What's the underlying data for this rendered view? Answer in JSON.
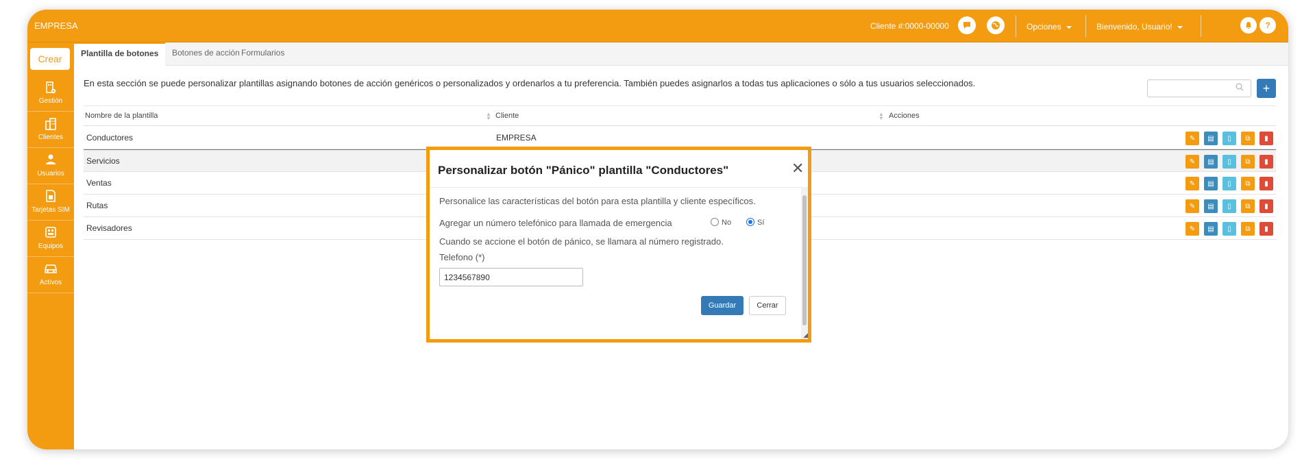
{
  "header": {
    "brand": "EMPRESA",
    "client_number": "Cliente #:0000-00000",
    "chat_icon": "chat-icon",
    "globe_icon": "globe-icon",
    "options_label": "Opciones",
    "welcome_label": "Bienvenido, Usuario!",
    "bell_icon": "bell-icon",
    "help_icon": "help-icon"
  },
  "sidebar": {
    "create_label": "Crear",
    "items": [
      {
        "label": "Gestión",
        "icon": "building-gear-icon"
      },
      {
        "label": "Clientes",
        "icon": "buildings-icon"
      },
      {
        "label": "Usuarios",
        "icon": "user-icon"
      },
      {
        "label": "Tarjetas SIM",
        "icon": "sim-card-icon"
      },
      {
        "label": "Equipos",
        "icon": "device-icon"
      },
      {
        "label": "Activos",
        "icon": "car-icon"
      }
    ]
  },
  "tabs": [
    "Plantilla de botones",
    "Botones de acción",
    "Formularios"
  ],
  "main": {
    "description": "En esta sección se puede personalizar plantillas asignando botones de acción genéricos o personalizados y ordenarlos a tu preferencia. También puedes asignarlos a todas tus aplicaciones o sólo a tus usuarios seleccionados.",
    "search_placeholder": "",
    "add_label": "+"
  },
  "table": {
    "columns": [
      "Nombre de la plantilla",
      "Cliente",
      "Acciones"
    ],
    "rows": [
      {
        "name": "Conductores",
        "client": "EMPRESA"
      },
      {
        "name": "Servicios",
        "client": ""
      },
      {
        "name": "Ventas",
        "client": ""
      },
      {
        "name": "Rutas",
        "client": ""
      },
      {
        "name": "Revisadores",
        "client": ""
      }
    ],
    "action_icons": [
      "edit-icon",
      "document-icon",
      "mobile-icon",
      "copy-icon",
      "delete-icon"
    ]
  },
  "modal": {
    "title": "Personalizar botón \"Pánico\" plantilla \"Conductores\"",
    "close_symbol": "✕",
    "intro": "Personalice las características del botón para esta plantilla y cliente específicos.",
    "question": "Agregar un número telefónico para llamada de emergencia",
    "option_no": "No",
    "option_yes": "Sí",
    "selected_option": "Sí",
    "note": "Cuando se accione el botón de pánico, se llamara al número registrado.",
    "phone_label": "Telefono (*)",
    "phone_value": "1234567890",
    "save_label": "Guardar",
    "close_label": "Cerrar"
  },
  "colors": {
    "accent": "#f39c12",
    "primary": "#337ab7",
    "info": "#5bc0de",
    "danger": "#dd4b39",
    "highlight": "#3c8dbc"
  }
}
